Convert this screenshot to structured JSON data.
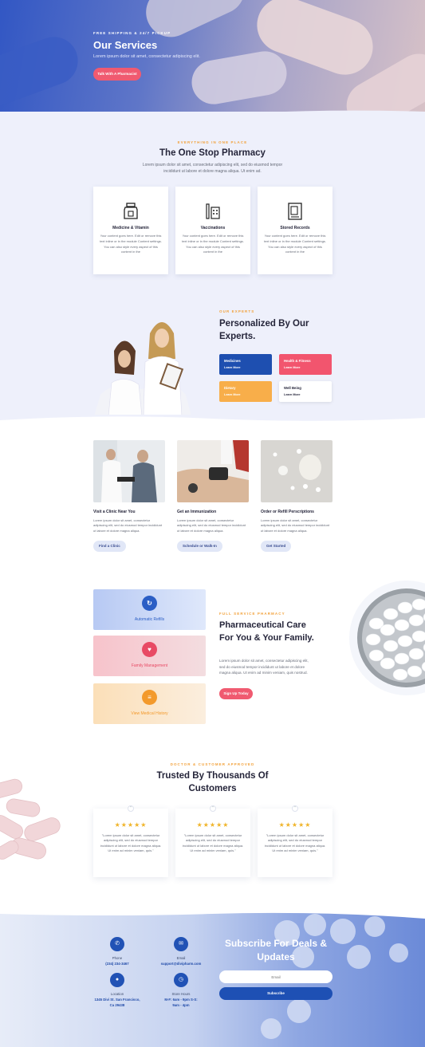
{
  "hero": {
    "kicker": "FREE SHIPPING & 24/7 PICKUP",
    "title": "Our Services",
    "subtitle": "Lorem ipsum dolor sit amet, consectetur adipiscing elit.",
    "button": "Talk With A Pharmacist"
  },
  "onestop": {
    "kicker": "EVERYTHING IN ONE PLACE",
    "title": "The One Stop Pharmacy",
    "text": "Lorem ipsum dolor sit amet, consectetur adipiscing elit, sed do eiusmod tempor incididunt ut labore et dolore magna aliqua. Ut enim ad.",
    "cards": [
      {
        "icon": "medicine-bottle-icon",
        "title": "Medicine & Vitamin",
        "text": "Your content goes here. Edit or remove this text inline or in the module Content settings. You can also style every aspect of this content in the"
      },
      {
        "icon": "syringe-icon",
        "title": "Vaccinations",
        "text": "Your content goes here. Edit or remove this text inline or in the module Content settings. You can also style every aspect of this content in the"
      },
      {
        "icon": "records-icon",
        "title": "Stored Records",
        "text": "Your content goes here. Edit or remove this text inline or in the module Content settings. You can also style every aspect of this content in the"
      }
    ]
  },
  "experts": {
    "kicker": "OUR EXPERTS",
    "title": "Personalized By Our Experts.",
    "tiles": [
      {
        "title": "Medicines",
        "link": "Learn More",
        "bg": "#1e4fb0",
        "fg": "#ffffff"
      },
      {
        "title": "Health & Fitness",
        "link": "Learn More",
        "bg": "#f2556e",
        "fg": "#ffffff"
      },
      {
        "title": "Dietary",
        "link": "Learn More",
        "bg": "#f8ae4a",
        "fg": "#ffffff"
      },
      {
        "title": "Well Being",
        "link": "Learn More",
        "bg": "#ffffff",
        "fg": "#25253a"
      }
    ]
  },
  "services": [
    {
      "title": "Visit a Clinic Near You",
      "text": "Lorem ipsum dolor sit amet, consectetur adipiscing elit, sed do eiusmod tempor incididunt ut labore et dolore magna aliqua.",
      "button": "Find a Clinic"
    },
    {
      "title": "Get an Immunization",
      "text": "Lorem ipsum dolor sit amet, consectetur adipiscing elit, sed do eiusmod tempor incididunt ut labore et dolore magna aliqua.",
      "button": "Schedule or Walk-In"
    },
    {
      "title": "Order or Refill Perscriptions",
      "text": "Lorem ipsum dolor sit amet, consectetur adipiscing elit, sed do eiusmod tempor incididunt ut labore et dolore magna aliqua.",
      "button": "Get Started"
    }
  ],
  "pharma": {
    "bands": [
      {
        "label": "Automatic Refills",
        "icon": "refresh-icon",
        "glyph": "↻",
        "color": "#2b5ec5"
      },
      {
        "label": "Family Management",
        "icon": "family-icon",
        "glyph": "♥",
        "color": "#e84a64"
      },
      {
        "label": "View Medical History",
        "icon": "history-icon",
        "glyph": "≡",
        "color": "#f39a2c"
      }
    ],
    "kicker": "FULL SERVICE PHARMACY",
    "title": "Pharmaceutical Care For You & Your Family.",
    "text": "Lorem ipsum dolor sit amet, consectetur adipiscing elit, sed do eiusmod tempor incididunt ut labore et dolore magna aliqua. Ut enim ad minim veniam, quis nostrud.",
    "button": "Sign Up Today"
  },
  "trusted": {
    "kicker": "DOCTOR & CUSTOMER APPROVED",
    "title": "Trusted By Thousands Of Customers",
    "stars": "★★★★★",
    "quote_mark": "“",
    "testimonials": [
      {
        "text": "\"Lorem ipsum dolor sit amet, consectetur adipiscing elit, sed do eiusmod tempor incididunt ut labore et dolore magna aliqua. Ut enim ad minim veniam, quis.\""
      },
      {
        "text": "\"Lorem ipsum dolor sit amet, consectetur adipiscing elit, sed do eiusmod tempor incididunt ut labore et dolore magna aliqua. Ut enim ad minim veniam, quis.\""
      },
      {
        "text": "\"Lorem ipsum dolor sit amet, consectetur adipiscing elit, sed do eiusmod tempor incididunt ut labore et dolore magna aliqua. Ut enim ad minim veniam, quis.\""
      }
    ]
  },
  "footer": {
    "phone": {
      "label": "Phone",
      "value": "(234) 234-3467",
      "icon": "phone-icon"
    },
    "email": {
      "label": "Email",
      "value": "support@diviphar​m.com",
      "icon": "mail-icon"
    },
    "location": {
      "label": "Location",
      "value": "1345 Divi St. San Francisco, Ca 29438",
      "icon": "location-icon"
    },
    "hours": {
      "label": "Store Hours",
      "value": "M-F: 6am - 9pm S-S: 9am - 4pm",
      "icon": "clock-icon"
    },
    "subscribe_title": "Subscribe For Deals & Updates",
    "email_placeholder": "Email",
    "subscribe_button": "Subscribe"
  }
}
